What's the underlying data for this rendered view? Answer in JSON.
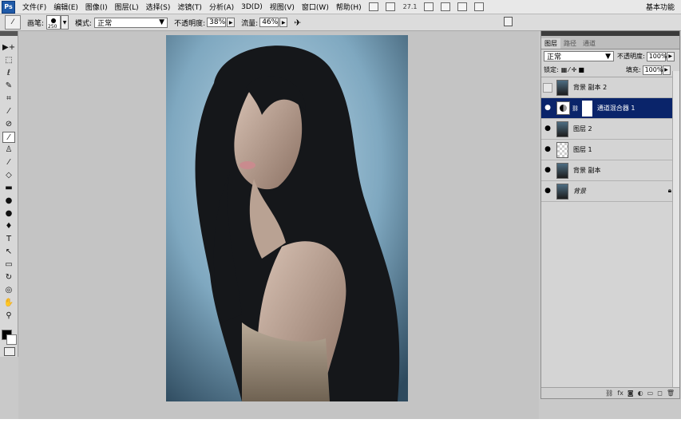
{
  "menubar": {
    "logo": "Ps",
    "items": [
      "文件(F)",
      "编辑(E)",
      "图像(I)",
      "图层(L)",
      "选择(S)",
      "滤镜(T)",
      "分析(A)",
      "3D(D)",
      "视图(V)",
      "窗口(W)",
      "帮助(H)"
    ],
    "zoom": "27.1",
    "workspace": "基本功能"
  },
  "options": {
    "brush_label": "画笔:",
    "brush_size": "250",
    "mode_label": "模式:",
    "mode_value": "正常",
    "opacity_label": "不透明度:",
    "opacity_value": "38%",
    "flow_label": "流量:",
    "flow_value": "46%"
  },
  "tools": [
    {
      "icon": "move-icon",
      "glyph": "▶+"
    },
    {
      "icon": "marquee-icon",
      "glyph": "⬚"
    },
    {
      "icon": "lasso-icon",
      "glyph": "ℓ"
    },
    {
      "icon": "quick-select-icon",
      "glyph": "✎"
    },
    {
      "icon": "crop-icon",
      "glyph": "⌗"
    },
    {
      "icon": "eyedropper-icon",
      "glyph": "⁄"
    },
    {
      "icon": "healing-icon",
      "glyph": "⊘"
    },
    {
      "icon": "brush-icon",
      "glyph": "⁄"
    },
    {
      "icon": "stamp-icon",
      "glyph": "♙"
    },
    {
      "icon": "history-brush-icon",
      "glyph": "⁄"
    },
    {
      "icon": "eraser-icon",
      "glyph": "◇"
    },
    {
      "icon": "gradient-icon",
      "glyph": "▬"
    },
    {
      "icon": "blur-icon",
      "glyph": "●"
    },
    {
      "icon": "dodge-icon",
      "glyph": "●"
    },
    {
      "icon": "pen-icon",
      "glyph": "♦"
    },
    {
      "icon": "type-icon",
      "glyph": "T"
    },
    {
      "icon": "path-select-icon",
      "glyph": "↖"
    },
    {
      "icon": "shape-icon",
      "glyph": "▭"
    },
    {
      "icon": "3d-rotate-icon",
      "glyph": "↻"
    },
    {
      "icon": "3d-orbit-icon",
      "glyph": "◎"
    },
    {
      "icon": "hand-icon",
      "glyph": "✋"
    },
    {
      "icon": "zoom-icon",
      "glyph": "⚲"
    }
  ],
  "panel": {
    "tabs": [
      "图层",
      "路径",
      "通道"
    ],
    "blend_mode": "正常",
    "opacity_label": "不透明度:",
    "opacity_value": "100%",
    "lock_label": "锁定:",
    "fill_label": "填充:",
    "fill_value": "100%",
    "layers": [
      {
        "name": "背景 副本 2",
        "visible": false,
        "selected": false,
        "kind": "photo",
        "locked": false
      },
      {
        "name": "通道混合器 1",
        "visible": true,
        "selected": true,
        "kind": "adjustment",
        "locked": false
      },
      {
        "name": "图层 2",
        "visible": true,
        "selected": false,
        "kind": "photo",
        "locked": false
      },
      {
        "name": "图层 1",
        "visible": true,
        "selected": false,
        "kind": "transparent",
        "locked": false
      },
      {
        "name": "背景 副本",
        "visible": true,
        "selected": false,
        "kind": "photo",
        "locked": false
      },
      {
        "name": "背景",
        "visible": true,
        "selected": false,
        "kind": "photo",
        "locked": true
      }
    ],
    "footer_icons": [
      "link-icon",
      "fx-icon",
      "mask-icon",
      "adjustment-icon",
      "folder-icon",
      "new-layer-icon",
      "trash-icon"
    ]
  }
}
